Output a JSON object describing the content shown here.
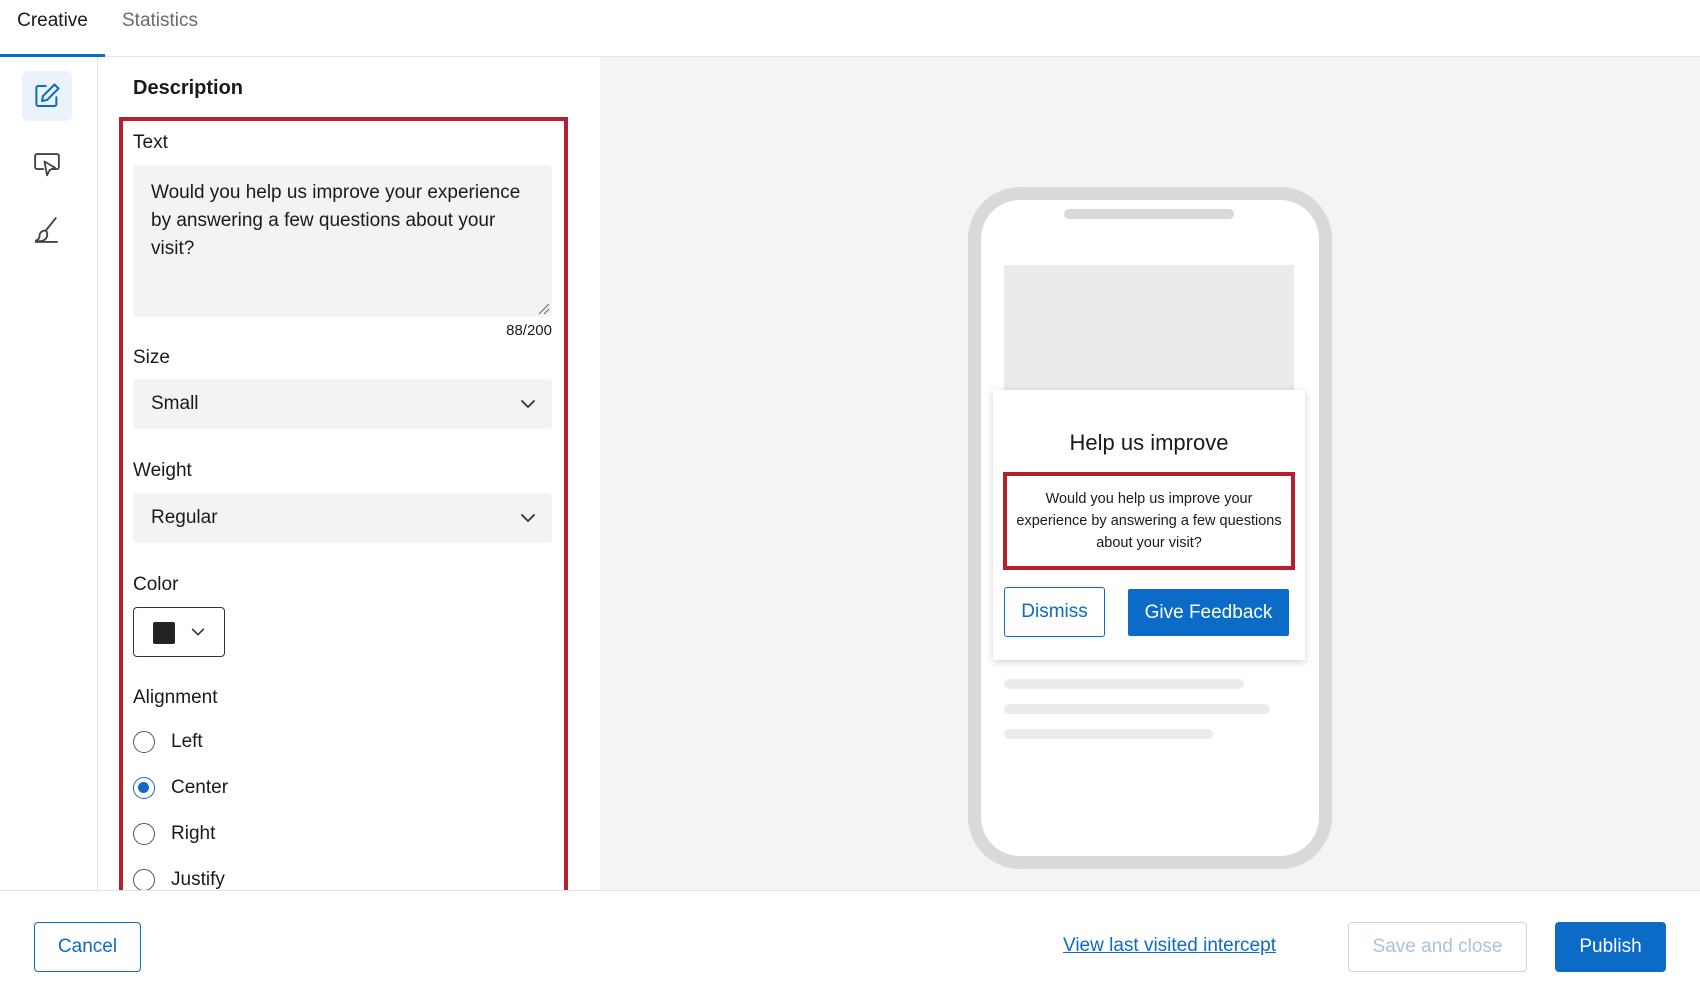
{
  "tabs": [
    {
      "label": "Creative",
      "active": true
    },
    {
      "label": "Statistics",
      "active": false
    }
  ],
  "rail": {
    "items": [
      {
        "icon": "edit-icon",
        "active": true
      },
      {
        "icon": "cursor-message-icon",
        "active": false
      },
      {
        "icon": "brush-icon",
        "active": false
      }
    ]
  },
  "panel": {
    "title": "Description",
    "text_label": "Text",
    "text_value": "Would you help us improve your experience by answering a few questions about your visit?",
    "counter": "88/200",
    "size_label": "Size",
    "size_value": "Small",
    "weight_label": "Weight",
    "weight_value": "Regular",
    "color_label": "Color",
    "color_value": "#222222",
    "alignment_label": "Alignment",
    "alignment_options": [
      {
        "label": "Left",
        "checked": false
      },
      {
        "label": "Center",
        "checked": true
      },
      {
        "label": "Right",
        "checked": false
      },
      {
        "label": "Justify",
        "checked": false
      }
    ]
  },
  "preview": {
    "card_title": "Help us improve",
    "card_body": "Would you help us improve your experience by answering a few questions about your visit?",
    "dismiss_label": "Dismiss",
    "feedback_label": "Give Feedback"
  },
  "footer": {
    "cancel_label": "Cancel",
    "link_label": "View last visited intercept",
    "save_label": "Save and close",
    "publish_label": "Publish"
  },
  "colors": {
    "accent": "#0b6bc7",
    "highlight": "#b5202e"
  }
}
